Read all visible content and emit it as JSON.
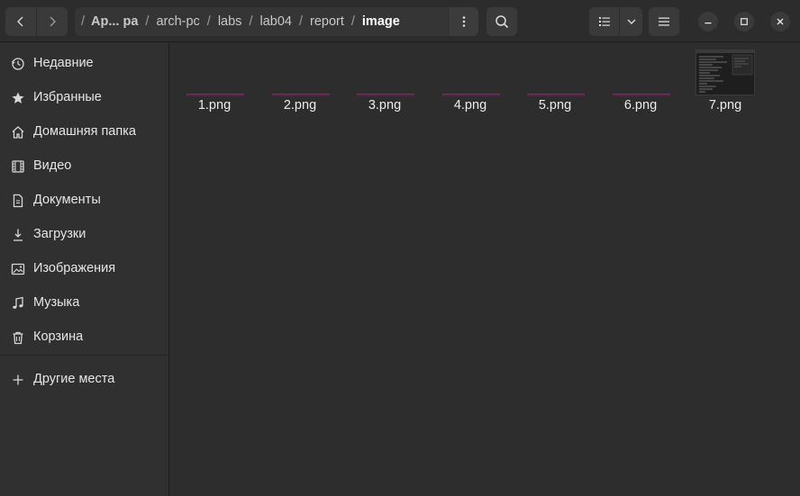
{
  "path": {
    "segments": [
      "Ар... ра",
      "arch-pc",
      "labs",
      "lab04",
      "report",
      "image"
    ]
  },
  "sidebar": {
    "items": [
      {
        "label": "Недавние",
        "icon": "clock-icon"
      },
      {
        "label": "Избранные",
        "icon": "star-icon"
      },
      {
        "label": "Домашняя папка",
        "icon": "home-icon"
      },
      {
        "label": "Видео",
        "icon": "film-icon"
      },
      {
        "label": "Документы",
        "icon": "document-icon"
      },
      {
        "label": "Загрузки",
        "icon": "download-icon"
      },
      {
        "label": "Изображения",
        "icon": "image-icon"
      },
      {
        "label": "Музыка",
        "icon": "music-icon"
      },
      {
        "label": "Корзина",
        "icon": "trash-icon"
      }
    ],
    "other": {
      "label": "Другие места",
      "icon": "plus-icon"
    }
  },
  "files": [
    {
      "name": "1.png"
    },
    {
      "name": "2.png"
    },
    {
      "name": "3.png"
    },
    {
      "name": "4.png"
    },
    {
      "name": "5.png"
    },
    {
      "name": "6.png"
    },
    {
      "name": "7.png"
    }
  ],
  "colors": {
    "background": "#2b2b2b",
    "sidebar": "#303030",
    "button": "#3a3a3a",
    "thumbnail_strip": "#4a2a40"
  }
}
